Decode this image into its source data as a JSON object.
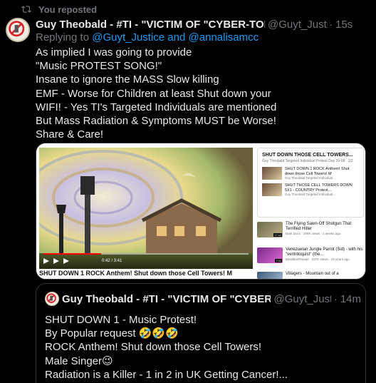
{
  "repost": {
    "label": "You reposted",
    "icon": "repost-icon"
  },
  "tweet": {
    "author_name": "Guy Theobald - #TI - \"VICTIM OF \"CYBER-TORTURE",
    "handle": "@Guyt_Justice",
    "dot": "·",
    "time": "15s",
    "replying_prefix": "Replying to",
    "replying_user1": "@Guyt_Justice",
    "replying_and": "and",
    "replying_user2": "@annalisamcc",
    "text_lines": [
      "As implied I was going to provide",
      "\"Music PROTEST SONG!\"",
      "Insane to ignore the MASS Slow killing",
      "EMF - Worse for Children at least Shut down your",
      "WIFI! - Yes TI's Targeted Individuals are mentioned",
      "But Mass Radiation & Symptoms MUST be Worse!",
      "Share & Care!"
    ]
  },
  "media": {
    "video_caption": "SHUT DOWN 1 ROCK Anthem! Shut down those Cell Towers! M",
    "time_label": "0:42 / 3:41",
    "progress_fraction": 0.28,
    "playlist": {
      "title": "SHUT DOWN THOSE CELL TOWERS...",
      "subtitle": "Guy Theobald Targeted Individual Protest Day 29-08 · 1/2",
      "items": [
        {
          "title": "SHUT DOWN 1 ROCK Anthem! Shut down those Cell Towers! M",
          "meta": "Guy Theobald Targeted Individual..."
        },
        {
          "title": "SHUT THOSE CELL TOWERS DOWN 5X1 - COUNTRY Protest...",
          "meta": "Guy Theobald Targeted Individual..."
        }
      ]
    },
    "recommendations": [
      {
        "title": "The Flying Sawn-Off Shotgun That Terrified Hitler",
        "meta": "Dark Docs · 266K views · 2 weeks ago",
        "duration": "17:44"
      },
      {
        "title": "Venezuelan Jungle Parrot (Sid) - with his \"ventriloquist\" (the...",
        "meta": "BandBoxParade · 237K views · 15 years ago",
        "duration": "7:01"
      },
      {
        "title": "Villagers - Mountain out of a",
        "meta": "",
        "duration": ""
      }
    ]
  },
  "quote": {
    "author_name": "Guy Theobald - #TI - \"VICTIM OF \"CYBER-TORTURE",
    "handle": "@Guyt_Justice",
    "dot": "·",
    "time": "14m",
    "text_lines": [
      "SHUT DOWN 1 - Music Protest!",
      "By Popular request 🤣🤣🤣",
      "ROCK Anthem! Shut down those Cell Towers!",
      "Male Singer😉",
      "Radiation is a Killer - 1 in 2 in UK Getting Cancer!..."
    ]
  },
  "colors": {
    "background": "#000000",
    "text": "#e7e9ea",
    "secondary": "#71767b",
    "link": "#1d9bf0",
    "border": "#2f3336"
  }
}
